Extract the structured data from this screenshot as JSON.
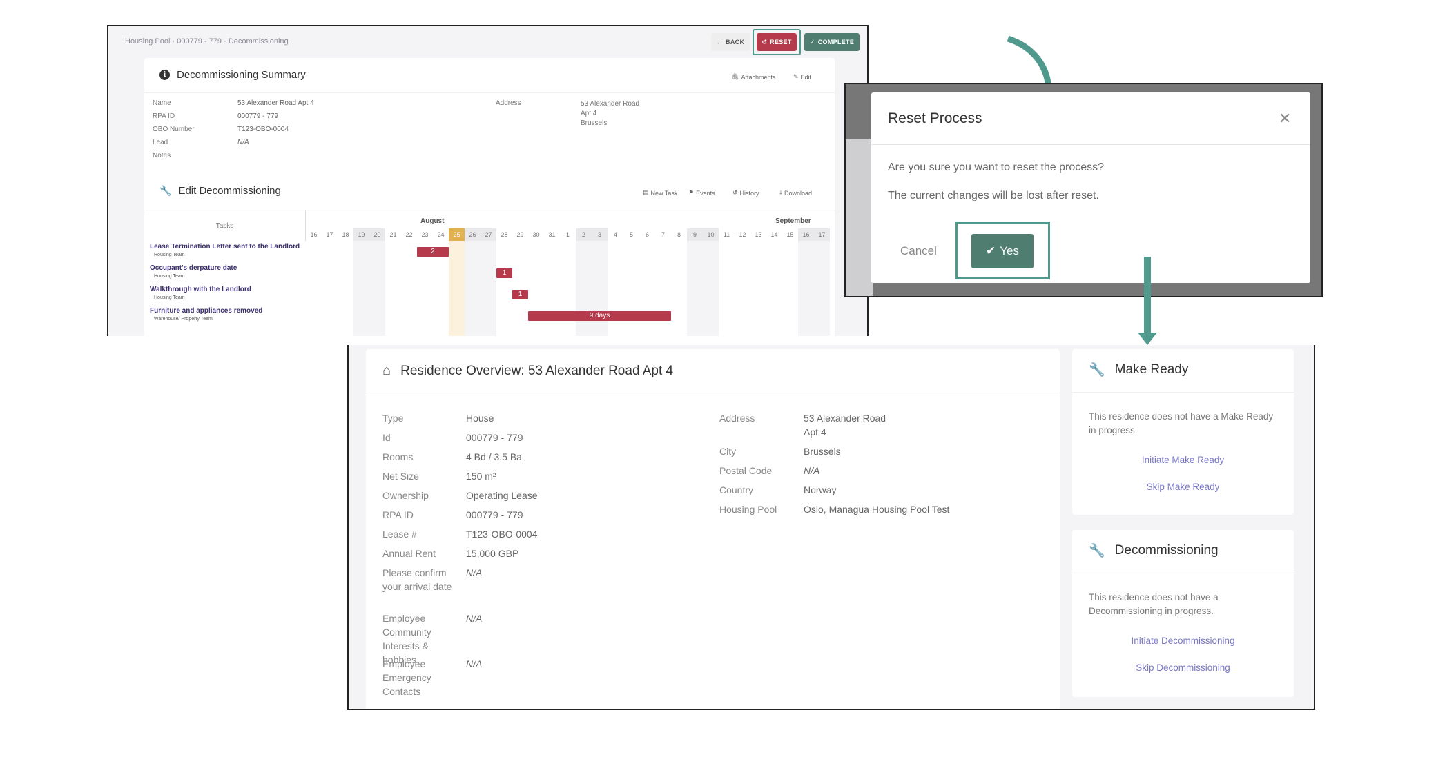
{
  "panel1": {
    "breadcrumb": "Housing Pool · 000779 - 779 · Decommissioning",
    "back": "BACK",
    "reset": "RESET",
    "complete": "COMPLETE",
    "summary": {
      "title": "Decommissioning Summary",
      "attachments": "Attachments",
      "edit": "Edit",
      "labels": [
        "Name",
        "RPA ID",
        "OBO Number",
        "Lead",
        "Notes"
      ],
      "values": [
        "53 Alexander Road Apt 4",
        "000779 - 779",
        "T123-OBO-0004",
        "N/A",
        ""
      ],
      "address_label": "Address",
      "address_lines": [
        "53 Alexander Road",
        "Apt 4",
        "Brussels"
      ]
    },
    "edit_section": {
      "title": "Edit Decommissioning",
      "new_task": "New Task",
      "events": "Events",
      "history": "History",
      "download": "Download",
      "tasks_header": "Tasks",
      "month1": "August",
      "month2": "September",
      "days": [
        "16",
        "17",
        "18",
        "19",
        "20",
        "21",
        "22",
        "23",
        "24",
        "25",
        "26",
        "27",
        "28",
        "29",
        "30",
        "31",
        "1",
        "2",
        "3",
        "4",
        "5",
        "6",
        "7",
        "8",
        "9",
        "10",
        "11",
        "12",
        "13",
        "14",
        "15",
        "16",
        "17"
      ],
      "weekend_flags": [
        0,
        0,
        0,
        1,
        1,
        0,
        0,
        0,
        0,
        1,
        1,
        1,
        0,
        0,
        0,
        0,
        0,
        1,
        1,
        0,
        0,
        0,
        0,
        0,
        1,
        1,
        0,
        0,
        0,
        0,
        0,
        1,
        1
      ],
      "today_index": 9,
      "tasks": [
        {
          "name": "Lease Termination Letter sent to the Landlord",
          "team": "Housing Team",
          "bar_label": "2",
          "start_index": 7,
          "days": 2
        },
        {
          "name": "Occupant's derpature date",
          "team": "Housing Team",
          "bar_label": "1",
          "start_index": 12,
          "days": 1
        },
        {
          "name": "Walkthrough with the Landlord",
          "team": "Housing Team",
          "bar_label": "1",
          "start_index": 13,
          "days": 1
        },
        {
          "name": "Furniture and appliances removed",
          "team": "Warehouse/ Property Team",
          "bar_label": "9 days",
          "start_index": 14,
          "days": 9
        }
      ]
    }
  },
  "dialog": {
    "title": "Reset Process",
    "close": "✕",
    "question": "Are you sure you want to reset the process?",
    "warning": "The current changes will be lost after reset.",
    "cancel": "Cancel",
    "yes": "Yes"
  },
  "overview": {
    "title": "Residence Overview: 53 Alexander Road Apt 4",
    "left": [
      {
        "label": "Type",
        "value": "House"
      },
      {
        "label": "Id",
        "value": "000779 - 779"
      },
      {
        "label": "Rooms",
        "value": "4 Bd / 3.5 Ba"
      },
      {
        "label": "Net Size",
        "value": "150 m²"
      },
      {
        "label": "Ownership",
        "value": "Operating Lease"
      },
      {
        "label": "RPA ID",
        "value": "000779 - 779"
      },
      {
        "label": "Lease #",
        "value": "T123-OBO-0004"
      },
      {
        "label": "Annual Rent",
        "value": "15,000 GBP"
      },
      {
        "label": "Please confirm your arrival date",
        "value": "N/A"
      },
      {
        "label": "Employee Community Interests & hobbies",
        "value": "N/A"
      },
      {
        "label": "Employee Emergency Contacts",
        "value": "N/A"
      }
    ],
    "right": [
      {
        "label": "Address",
        "value": "53 Alexander Road\nApt 4"
      },
      {
        "label": "City",
        "value": "Brussels"
      },
      {
        "label": "Postal Code",
        "value": "N/A"
      },
      {
        "label": "Country",
        "value": "Norway"
      },
      {
        "label": "Housing Pool",
        "value": "Oslo, Managua Housing Pool Test"
      }
    ]
  },
  "make_ready": {
    "title": "Make Ready",
    "message": "This residence does not have a Make Ready in progress.",
    "initiate": "Initiate Make Ready",
    "skip": "Skip Make Ready"
  },
  "decommissioning": {
    "title": "Decommissioning",
    "message": "This residence does not have a Decommissioning in progress.",
    "initiate": "Initiate Decommissioning",
    "skip": "Skip Decommissioning"
  },
  "colors": {
    "accent": "#4f9a8c",
    "danger": "#b43a4c",
    "primary": "#4f7d6f",
    "today": "#e1b04f",
    "link": "#7b78c8"
  }
}
